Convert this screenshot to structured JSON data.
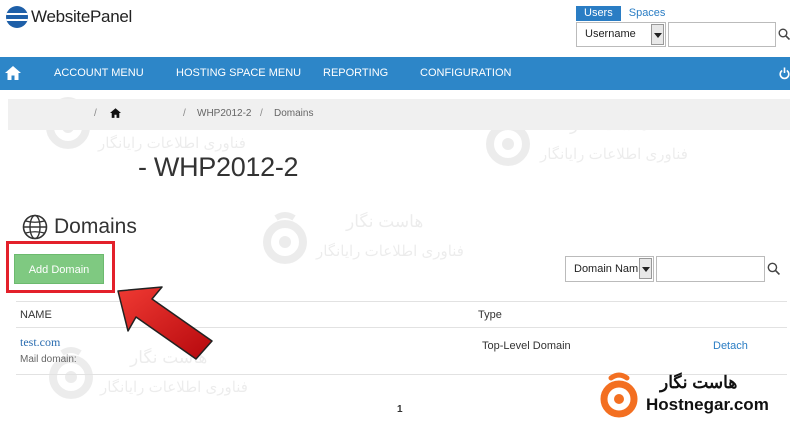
{
  "app": {
    "logo_text": "WebsitePanel"
  },
  "top_search": {
    "tabs": [
      {
        "label": "Users",
        "active": true
      },
      {
        "label": "Spaces",
        "active": false
      }
    ],
    "field_select": "Username",
    "input_value": ""
  },
  "nav": {
    "items": [
      {
        "label": "ACCOUNT MENU"
      },
      {
        "label": "HOSTING SPACE MENU"
      },
      {
        "label": "REPORTING"
      },
      {
        "label": "CONFIGURATION"
      }
    ]
  },
  "breadcrumb": {
    "items": [
      "WHP2012-2",
      "Domains"
    ]
  },
  "page": {
    "title": "- WHP2012-2"
  },
  "section": {
    "title": "Domains",
    "add_button": "Add Domain"
  },
  "filter": {
    "select_value": "Domain Nam",
    "input_value": ""
  },
  "table": {
    "columns": [
      "NAME",
      "Type"
    ],
    "rows": [
      {
        "name": "test.com",
        "sub": "Mail domain:",
        "type": "Top-Level Domain",
        "action": "Detach"
      }
    ]
  },
  "pagination": {
    "current": "1"
  },
  "watermark": {
    "line1": "هاست نگار",
    "line2": "فناوری اطلاعات رایانگار"
  },
  "brand": {
    "fa": "هاست نگار",
    "en": "Hostnegar.com"
  },
  "colors": {
    "nav_bg": "#2d86c8",
    "add_button": "#7fc981",
    "highlight": "#e3202a",
    "link": "#2a6cb0"
  }
}
